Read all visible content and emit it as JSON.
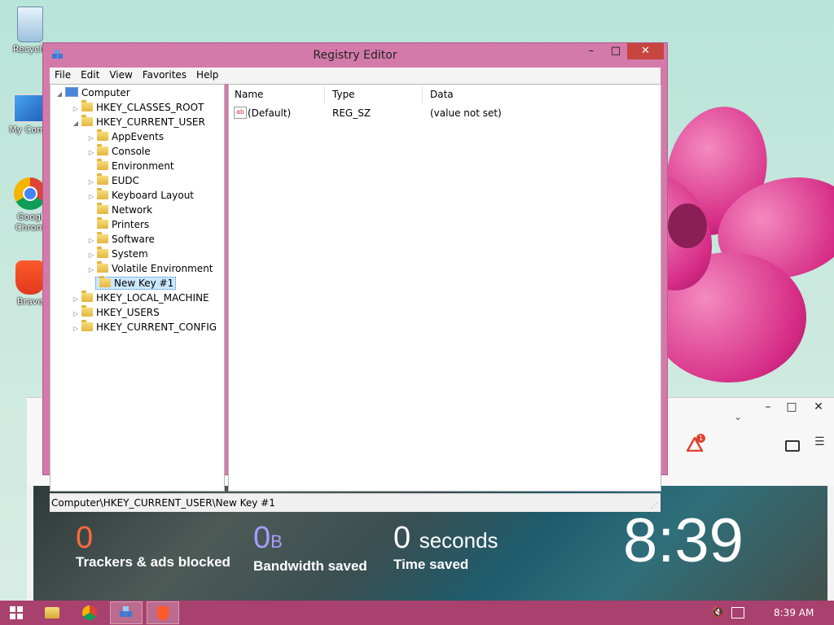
{
  "desktop": {
    "icons": [
      {
        "label": "Recycle"
      },
      {
        "label": "My Comp"
      },
      {
        "label": "Googl Chrom"
      },
      {
        "label": "Brave"
      }
    ]
  },
  "registry": {
    "title": "Registry Editor",
    "window_buttons": {
      "minimize": "–",
      "maximize": "□",
      "close": "✕"
    },
    "menu": [
      "File",
      "Edit",
      "View",
      "Favorites",
      "Help"
    ],
    "tree": {
      "root": "Computer",
      "hkcr": "HKEY_CLASSES_ROOT",
      "hkcu": "HKEY_CURRENT_USER",
      "hkcu_children": [
        "AppEvents",
        "Console",
        "Environment",
        "EUDC",
        "Keyboard Layout",
        "Network",
        "Printers",
        "Software",
        "System",
        "Volatile Environment",
        "New Key #1"
      ],
      "hklm": "HKEY_LOCAL_MACHINE",
      "hku": "HKEY_USERS",
      "hkcc": "HKEY_CURRENT_CONFIG"
    },
    "list": {
      "headers": {
        "name": "Name",
        "type": "Type",
        "data": "Data"
      },
      "rows": [
        {
          "name": "(Default)",
          "type": "REG_SZ",
          "data": "(value not set)"
        }
      ]
    },
    "status": "Computer\\HKEY_CURRENT_USER\\New Key #1"
  },
  "brave": {
    "controls": {
      "minimize": "–",
      "maximize": "□",
      "close": "✕"
    },
    "notification_count": "1",
    "stats": {
      "trackers_value": "0",
      "trackers_label": "Trackers & ads blocked",
      "bandwidth_value": "0",
      "bandwidth_unit": "B",
      "bandwidth_label": "Bandwidth saved",
      "time_value": "0",
      "time_unit": "seconds",
      "time_label": "Time saved"
    },
    "clock": "8:39"
  },
  "taskbar": {
    "time": "8:39 AM"
  },
  "colors": {
    "taskbar": "#a9416e",
    "window_frame": "#d37aaa",
    "trackers_value": "#ff6a3d",
    "bandwidth_value": "#a79cff"
  }
}
